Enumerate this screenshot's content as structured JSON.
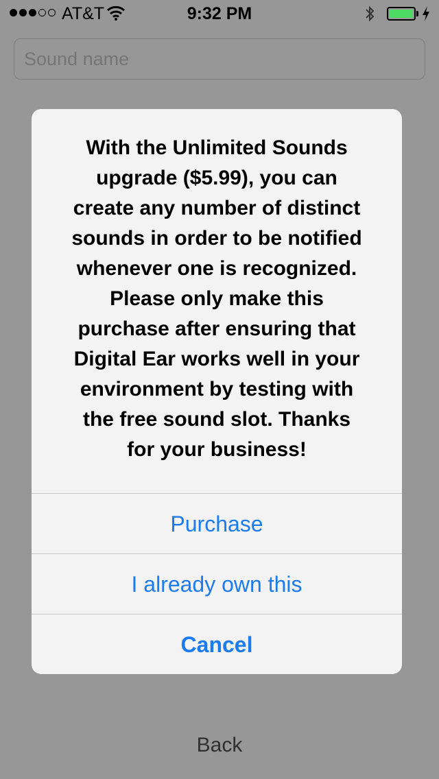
{
  "status_bar": {
    "carrier": "AT&T",
    "time": "9:32 PM",
    "signal_bars_filled": 3,
    "signal_bars_total": 5,
    "battery_level": 1.0,
    "battery_color": "#4cd964"
  },
  "form": {
    "sound_name_placeholder": "Sound name",
    "sound_name_value": ""
  },
  "alert": {
    "message_lines": [
      "With the Unlimited Sounds",
      "upgrade ($5.99), you can",
      "create any number of distinct",
      "sounds in order to be notified",
      "whenever one is recognized.",
      "Please only make this",
      "purchase after ensuring that",
      "Digital Ear works well in your",
      "environment by testing with",
      "the free sound slot. Thanks",
      "for your business!"
    ],
    "buttons": {
      "purchase": "Purchase",
      "already_own": "I already own this",
      "cancel": "Cancel"
    },
    "button_color": "#1a7cf0"
  },
  "footer": {
    "back_label": "Back"
  }
}
